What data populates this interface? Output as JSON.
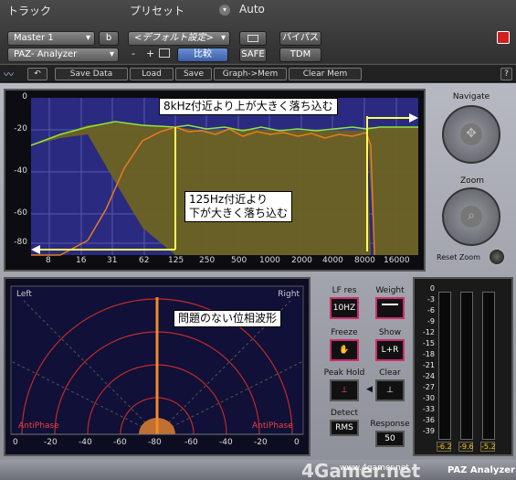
{
  "header": {
    "track_label": "トラック",
    "preset_label": "プリセット",
    "auto_label": "Auto",
    "track_name": "Master 1",
    "track_channel": "b",
    "preset_name": "<デフォルト設定>",
    "plugin_name": "PAZ- Analyzer",
    "minus": "-",
    "plus": "+",
    "compare": "比較",
    "safe": "SAFE",
    "bypass": "バイパス",
    "tdm": "TDM"
  },
  "toolbar": {
    "save_data": "Save Data",
    "load": "Load",
    "save": "Save",
    "graph_mem": "Graph->Mem",
    "clear_mem": "Clear Mem",
    "help": "?"
  },
  "spectrum": {
    "y_ticks": [
      "0",
      "-20",
      "-40",
      "-60",
      "-80"
    ],
    "x_ticks": [
      "8",
      "16",
      "31",
      "62",
      "125",
      "250",
      "500",
      "1000",
      "2000",
      "4000",
      "8000",
      "16000"
    ]
  },
  "callouts": {
    "high": "8kHz付近より上が大きく落ち込む",
    "low_line1": "125Hz付近より",
    "low_line2": "下が大きく落ち込む",
    "phase": "問題のない位相波形"
  },
  "navigate": {
    "title": "Navigate",
    "zoom": "Zoom",
    "reset_zoom": "Reset Zoom"
  },
  "phase": {
    "left": "Left",
    "right": "Right",
    "antiphase_left": "AntiPhase",
    "antiphase_right": "AntiPhase",
    "x_ticks": [
      "0",
      "-20",
      "-40",
      "-60",
      "-80",
      "-60",
      "-40",
      "-20",
      "0"
    ]
  },
  "controls": {
    "lf_res": "LF res",
    "lf_res_value": "10HZ",
    "weight": "Weight",
    "freeze": "Freeze",
    "show": "Show",
    "show_value": "L+R",
    "peak_hold": "Peak Hold",
    "clear": "Clear",
    "detect": "Detect",
    "detect_value": "RMS",
    "response": "Response",
    "response_value": "50"
  },
  "meters": {
    "scale": [
      "0",
      "-3",
      "-6",
      "-9",
      "-12",
      "-15",
      "-18",
      "-21",
      "-24",
      "-27",
      "-30",
      "-33",
      "-36",
      "-39"
    ],
    "readouts": [
      "-6.2",
      "-9.6",
      "-5.2"
    ]
  },
  "footer": {
    "brand": "PAZ Analyzer",
    "watermark": "4Gamer.net",
    "url": "www.4gamer.net"
  },
  "colors": {
    "spectrum_bg": "#2a2a80",
    "fill": "#6b6322",
    "green_line": "#8fe63a",
    "orange_line": "#e87a1e",
    "highlight": "#ffff55",
    "phase_arc": "#c02a2a",
    "accent_pink": "#d02c6b"
  }
}
